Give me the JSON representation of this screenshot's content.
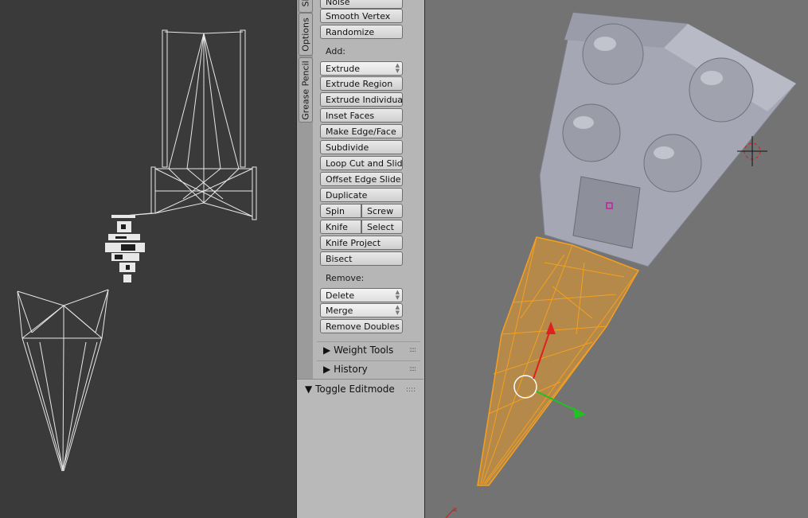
{
  "tabs": [
    "Sl",
    "Options",
    "Grease Pencil"
  ],
  "tools": {
    "top_buttons": [
      "Noise",
      "Smooth Vertex",
      "Randomize"
    ],
    "add_label": "Add:",
    "extrude_dropdown": "Extrude",
    "add_buttons": [
      "Extrude Region",
      "Extrude Individual",
      "Inset Faces",
      "Make Edge/Face",
      "Subdivide",
      "Loop Cut and Slide",
      "Offset Edge Slide",
      "Duplicate"
    ],
    "spin": "Spin",
    "screw": "Screw",
    "knife": "Knife",
    "select": "Select",
    "knife_project": "Knife Project",
    "bisect": "Bisect",
    "remove_label": "Remove:",
    "delete_dropdown": "Delete",
    "merge_dropdown": "Merge",
    "remove_doubles": "Remove Doubles"
  },
  "subpanels": {
    "weight_tools": "Weight Tools",
    "history": "History"
  },
  "toggle_panel": {
    "title": "Toggle Editmode"
  },
  "viewport": {
    "axis_label": "x",
    "colors": {
      "selection": "#f5a020",
      "hull": "#a5a7b4",
      "wire_left": "#e8e8e8",
      "background_left": "#3a3a3a",
      "background_right": "#737373",
      "axis_y": "#e02020",
      "axis_x": "#1fc21f"
    }
  }
}
